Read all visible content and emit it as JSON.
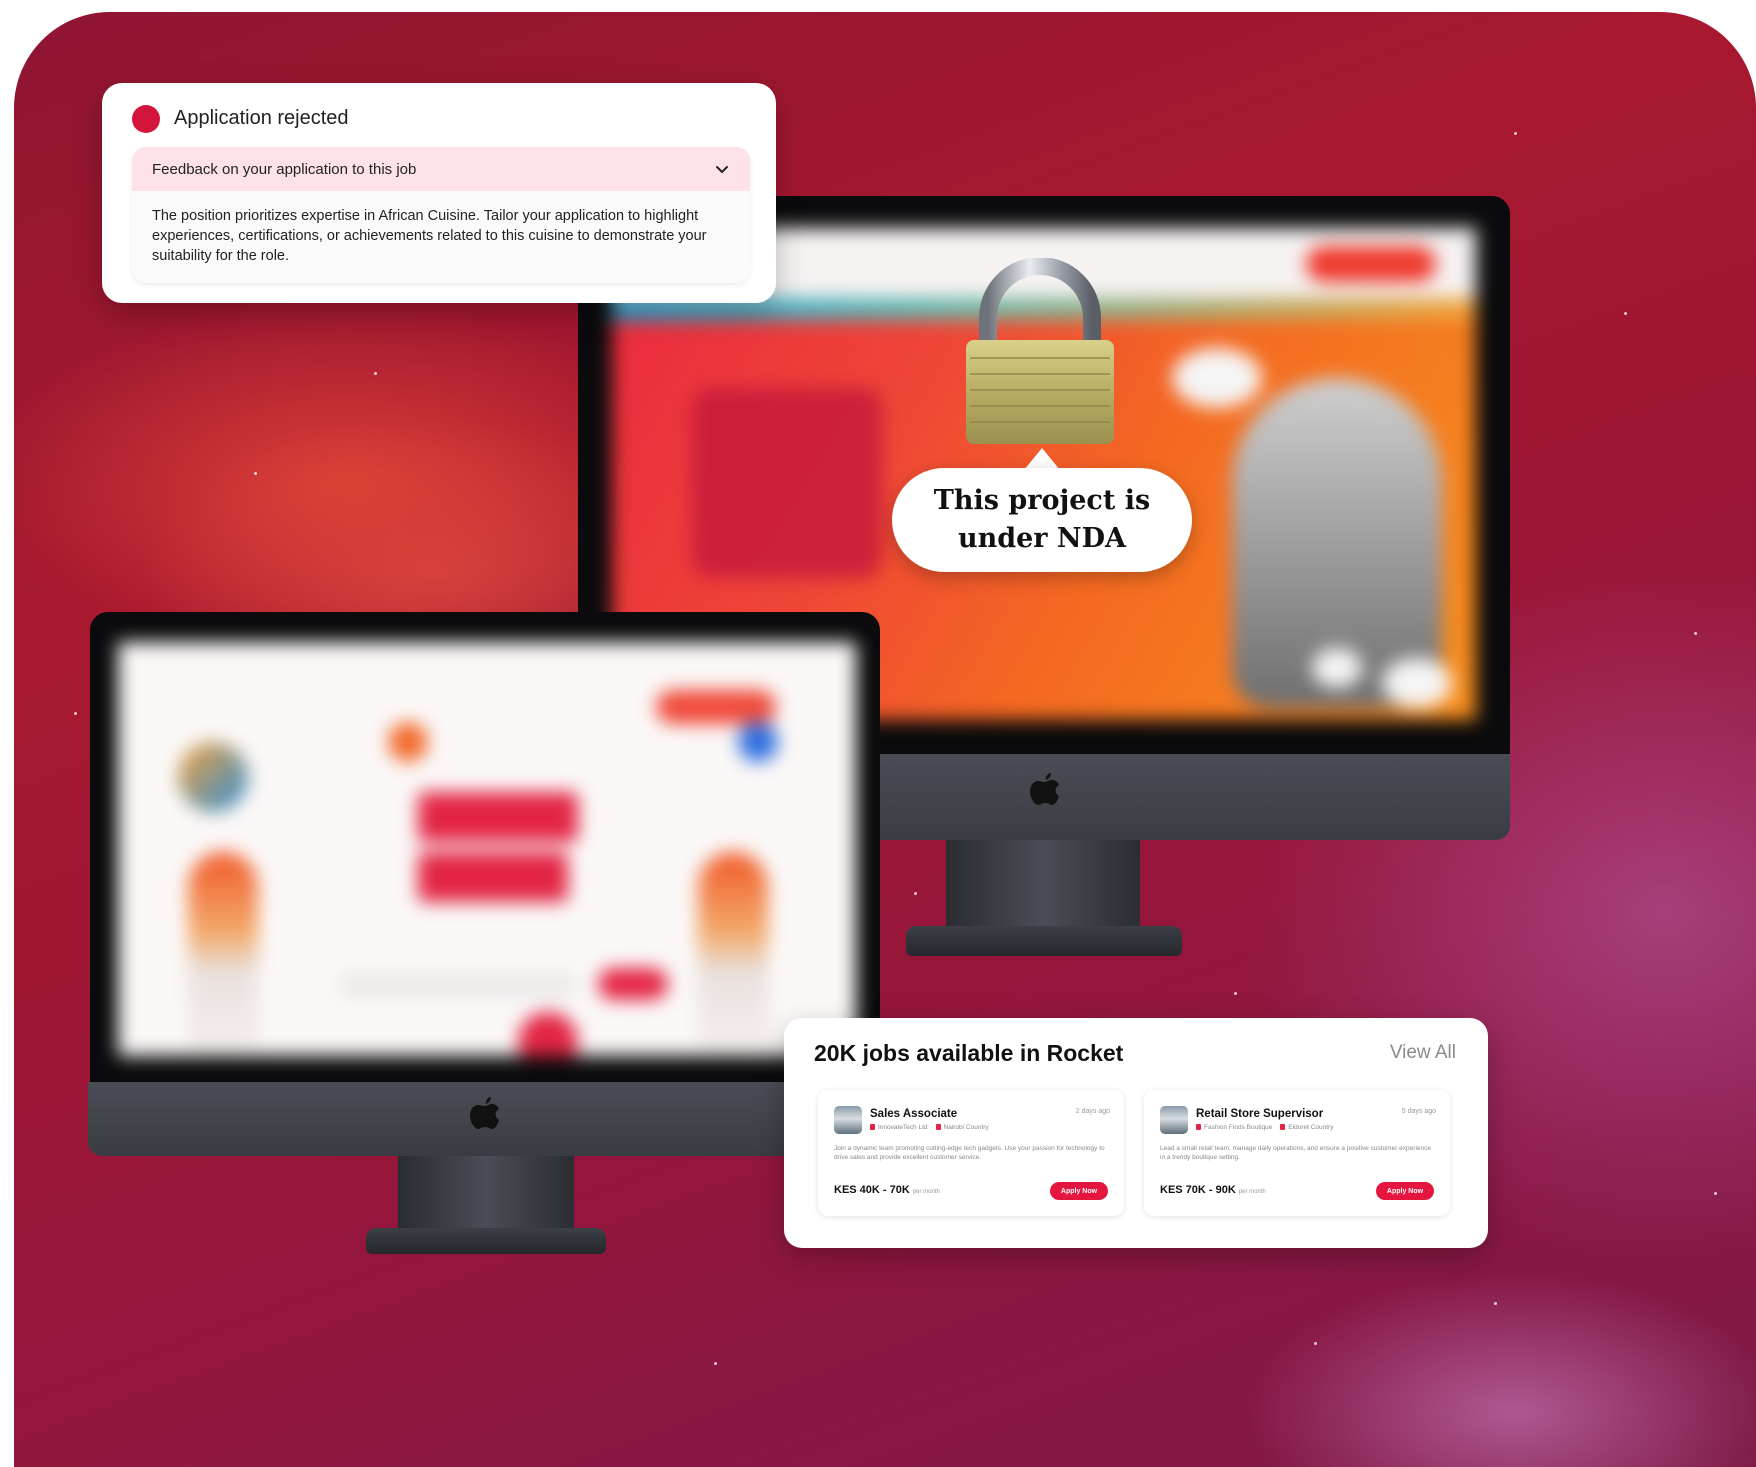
{
  "rejection_card": {
    "status": "Application rejected",
    "feedback_header": "Feedback on your application to this job",
    "feedback_body": "The position prioritizes expertise in African Cuisine. Tailor your application to highlight experiences, certifications, or achievements related to this cuisine to demonstrate your suitability for the role.",
    "status_color": "#d4153b",
    "icons": {
      "status": "red-dot-icon",
      "expand": "chevron-down-icon"
    }
  },
  "nda": {
    "line1": "This project is",
    "line2": "under NDA",
    "icon": "padlock-icon"
  },
  "jobs_card": {
    "title": "20K jobs available in Rocket",
    "view_all": "View All",
    "jobs": [
      {
        "title": "Sales Associate",
        "age": "2 days ago",
        "company": "InnovateTech Ltd",
        "location": "Nairobi Country",
        "description": "Join a dynamic team promoting cutting-edge tech gadgets. Use your passion for technology to drive sales and provide excellent customer service.",
        "salary": "KES 40K - 70K",
        "period": "per month",
        "apply": "Apply Now"
      },
      {
        "title": "Retail Store Supervisor",
        "age": "5 days ago",
        "company": "Fashion Finds Boutique",
        "location": "Eldoret Country",
        "description": "Lead a small retail team, manage daily operations, and ensure a positive customer experience in a trendy boutique setting.",
        "salary": "KES 70K - 90K",
        "period": "per month",
        "apply": "Apply Now"
      }
    ],
    "accent_color": "#e4163f"
  },
  "devices": {
    "icon": "apple-logo-icon"
  }
}
